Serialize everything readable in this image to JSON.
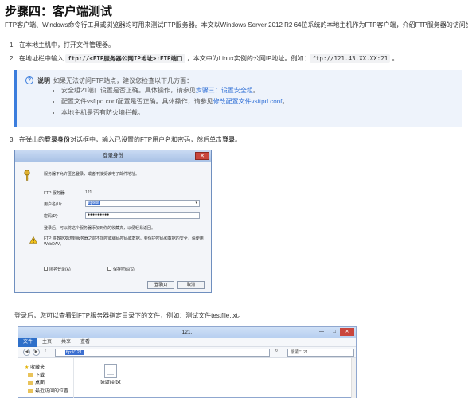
{
  "page": {
    "title": "步骤四：客户端测试",
    "intro": "FTP客户端、Windows命令行工具或浏览器均可用来测试FTP服务器。本文以Windows Server 2012 R2 64位系统的本地主机作为FTP客户端，介绍FTP服务器的访问步骤。"
  },
  "steps": {
    "s1": {
      "num": "1.",
      "text": "在本地主机中，打开文件管理器。"
    },
    "s2": {
      "num": "2.",
      "pre": "在地址栏中输入 ",
      "code1": "ftp://<FTP服务器公网IP地址>:FTP端口",
      "mid": " ，本文中为Linux实例的公网IP地址。例如：",
      "code2": "ftp://121.43.XX.XX:21",
      "post": " 。"
    },
    "s3": {
      "num": "3.",
      "pre": "在弹出的",
      "b1": "登录身份",
      "mid": "对话框中，输入已设置的FTP用户名和密码，然后单击",
      "b2": "登录",
      "post": "。"
    },
    "after": "登录后，您可以查看到FTP服务器指定目录下的文件，例如：测试文件testfile.txt。"
  },
  "note": {
    "label": "说明",
    "head": "如果无法访问FTP站点，建议您检查以下几方面：",
    "items": [
      {
        "pre": "安全组21端口设置是否正确。具体操作，请参见",
        "link": "步骤三：设置安全组",
        "post": "。"
      },
      {
        "pre": "配置文件vsftpd.conf配置是否正确。具体操作，请参见",
        "link": "修改配置文件vsftpd.conf",
        "post": "。"
      },
      {
        "pre": "本地主机是否有防火墙拦截。",
        "link": "",
        "post": ""
      }
    ]
  },
  "dialog": {
    "title": "登录身份",
    "close": "✕",
    "msg": "服务器不允许匿名登录，或者不接受该电子邮件地址。",
    "server_label": "FTP 服务器:",
    "server_value": "121.",
    "user_label": "用户名(U):",
    "user_value": "ftptest",
    "pass_label": "密码(P):",
    "pass_value": "●●●●●●●●●",
    "info": "登录后，可以将这个服务器添加到你的收藏夹，以便轻易返回。",
    "warn": "FTP 将数据发送到服务器之前不加密或编码密码或数据。要保护密码和数据的安全，请使用 WebDAV。",
    "anon": "匿名登录(A)",
    "save": "保存密码(S)",
    "login_btn": "登录(L)",
    "cancel_btn": "取消"
  },
  "explorer": {
    "title": "121.",
    "min": "—",
    "max": "□",
    "close": "✕",
    "tabs": [
      "文件",
      "主页",
      "共享",
      "查看"
    ],
    "address": "ftp://121.",
    "search": "搜索\"121.",
    "nav": [
      "收藏夹",
      "下载",
      "桌面",
      "最近访问的位置"
    ],
    "file": "testfile.txt",
    "colors": {
      "accent": "#2e6fc9",
      "note_border": "#3b7ddd",
      "close_red": "#c9463d"
    }
  }
}
